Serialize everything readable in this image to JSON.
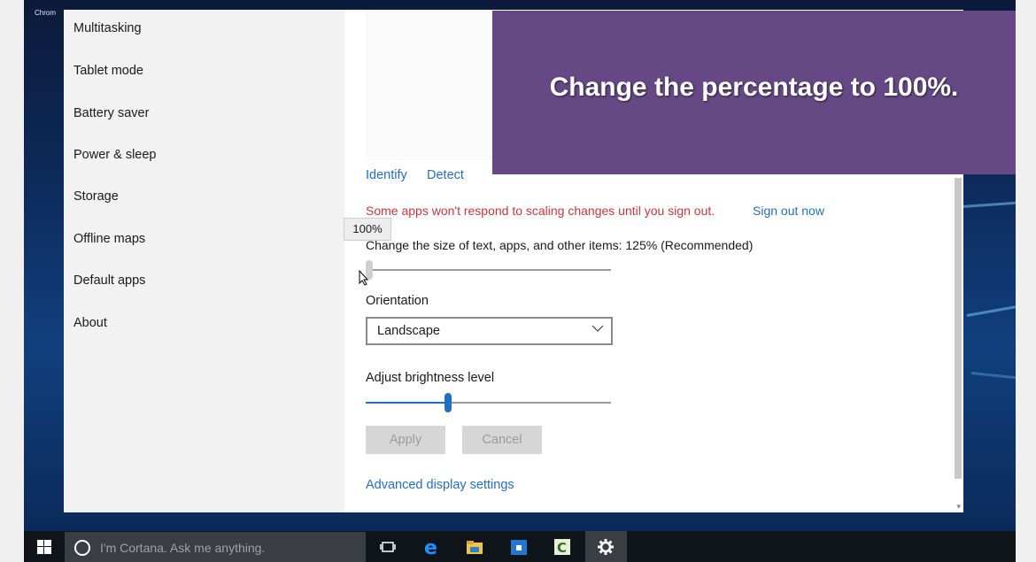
{
  "window": {
    "app_label": "Chrom"
  },
  "sidebar": {
    "items": [
      {
        "label": "Multitasking"
      },
      {
        "label": "Tablet mode"
      },
      {
        "label": "Battery saver"
      },
      {
        "label": "Power & sleep"
      },
      {
        "label": "Storage"
      },
      {
        "label": "Offline maps"
      },
      {
        "label": "Default apps"
      },
      {
        "label": "About"
      }
    ]
  },
  "display": {
    "identify_label": "Identify",
    "detect_label": "Detect",
    "scaling_warning": "Some apps won't respond to scaling changes until you sign out.",
    "sign_out_label": "Sign out now",
    "scale_label": "Change the size of text, apps, and other items: 125% (Recommended)",
    "scale_tooltip": "100%",
    "scale_level_fraction": 0.0,
    "orientation_label": "Orientation",
    "orientation_value": "Landscape",
    "brightness_label": "Adjust brightness level",
    "brightness_level_fraction": 0.33,
    "apply_label": "Apply",
    "cancel_label": "Cancel",
    "advanced_label": "Advanced display settings"
  },
  "overlay": {
    "instruction": "Change the percentage to 100%."
  },
  "taskbar": {
    "search_placeholder": "I'm Cortana. Ask me anything.",
    "icons": [
      "task-view-icon",
      "edge-icon",
      "file-explorer-icon",
      "store-icon",
      "camtasia-icon",
      "settings-gear-icon"
    ]
  },
  "colors": {
    "accent": "#1f6fc5",
    "warning": "#d13438",
    "banner": "#654884",
    "taskbar": "#0f1419"
  }
}
